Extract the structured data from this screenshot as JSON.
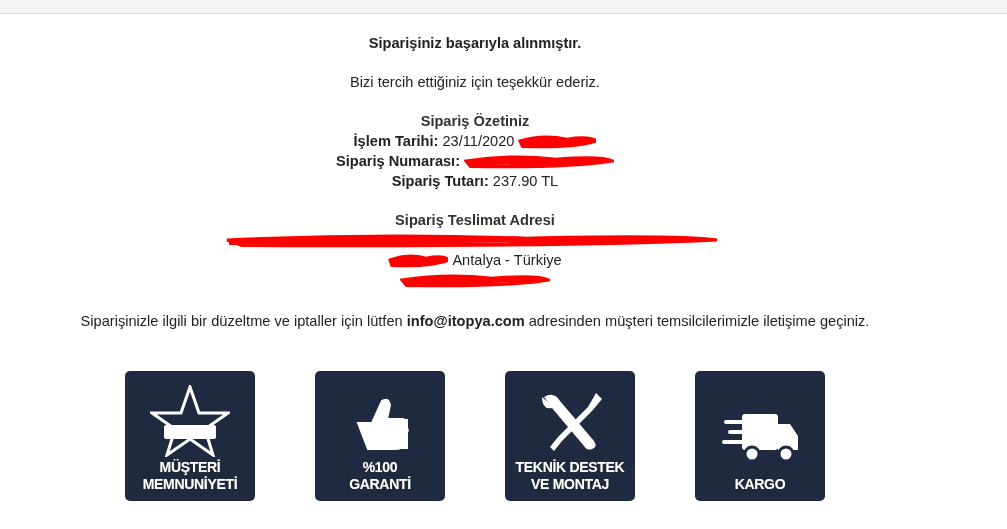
{
  "confirmation": {
    "title": "Siparişiniz başarıyla alınmıştır.",
    "thanks": "Bizi tercih ettiğiniz için teşekkür ederiz."
  },
  "summary": {
    "title": "Sipariş Özetiniz",
    "fields": [
      {
        "label": "İşlem Tarihi:",
        "value": "23/11/2020",
        "redacted": true
      },
      {
        "label": "Sipariş Numarası:",
        "redacted": true
      },
      {
        "label": "Sipariş Tutarı:",
        "value": "237.90 TL",
        "redacted": false
      }
    ]
  },
  "address": {
    "title": "Sipariş Teslimat Adresi",
    "lines": [
      {
        "redacted": true
      },
      {
        "text": "Antalya - Türkiye",
        "redacted": true
      },
      {
        "redacted": true
      }
    ]
  },
  "contact_note": "Siparişinizle ilgili bir düzeltme ve iptaller için lütfen **info@itopya.com** adresinden müşteri temsilcilerimizle iletişime geçiniz.",
  "badges": [
    {
      "kind": "star",
      "lines": [
        "MÜŞTERİ",
        "MEMNUNİYETİ"
      ]
    },
    {
      "kind": "thumb",
      "lines": [
        "%100",
        "GARANTİ"
      ]
    },
    {
      "kind": "tools",
      "lines": [
        "TEKNİK DESTEK",
        "VE MONTAJ"
      ]
    },
    {
      "kind": "truck",
      "lines": [
        "KARGO"
      ]
    }
  ]
}
